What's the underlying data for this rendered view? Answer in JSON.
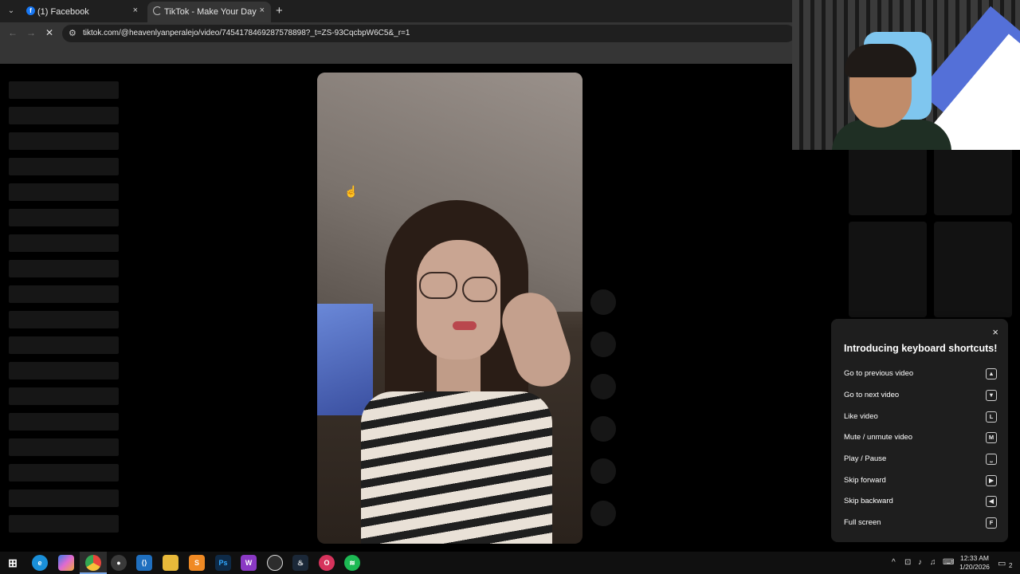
{
  "browser": {
    "tabs": [
      {
        "label": "(1) Facebook",
        "favicon": "facebook-icon",
        "active": false
      },
      {
        "label": "TikTok - Make Your Day",
        "favicon": "loading-spinner-icon",
        "active": true
      }
    ],
    "new_tab_symbol": "+",
    "close_symbol": "×",
    "url": "tiktok.com/@heavenlyanperalejo/video/7454178469287578898?_t=ZS-93CqcbpW6C5&_r=1"
  },
  "shortcuts_panel": {
    "title": "Introducing keyboard shortcuts!",
    "close_symbol": "×",
    "items": [
      {
        "label": "Go to previous video",
        "key": "▲"
      },
      {
        "label": "Go to next video",
        "key": "▼"
      },
      {
        "label": "Like video",
        "key": "L"
      },
      {
        "label": "Mute / unmute video",
        "key": "M"
      },
      {
        "label": "Play / Pause",
        "key": "⎵"
      },
      {
        "label": "Skip forward",
        "key": "▶"
      },
      {
        "label": "Skip backward",
        "key": "◀"
      },
      {
        "label": "Full screen",
        "key": "F"
      }
    ]
  },
  "taskbar": {
    "clock_time": "12:33 AM",
    "clock_date": "1/20/2026",
    "notification_count": "2",
    "apps": [
      "start-icon",
      "edge-icon",
      "copilot-icon",
      "chrome-icon",
      "obs-icon",
      "vscode-icon",
      "file-explorer-icon",
      "sublime-icon",
      "photoshop-icon",
      "winamp-icon",
      "app-icon",
      "steam-icon",
      "opera-gx-icon",
      "spotify-icon"
    ]
  },
  "colors": {
    "facebook": "#1877f2",
    "spotify": "#1db954",
    "panel_bg": "#1e1e1e"
  }
}
